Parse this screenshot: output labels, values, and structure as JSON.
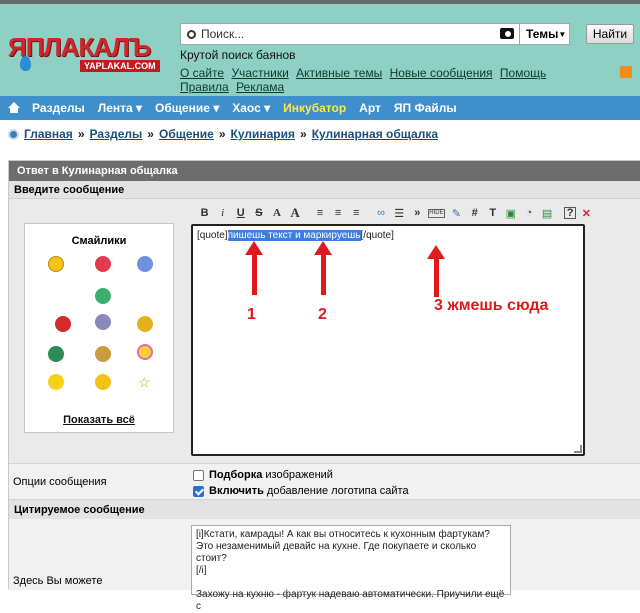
{
  "header": {
    "logo_text": "ЯПЛАКАЛЪ",
    "logo_sub": "YAPLAKAL.COM",
    "search_placeholder": "Поиск...",
    "themes_label": "Темы",
    "find_label": "Найти",
    "tagline": "Крутой поиск баянов",
    "links": [
      "О сайте",
      "Участники",
      "Активные темы",
      "Новые сообщения",
      "Помощь",
      "Правила",
      "Реклама"
    ]
  },
  "nav": {
    "items": [
      {
        "label": "Разделы",
        "hot": false
      },
      {
        "label": "Лента ▾",
        "hot": false
      },
      {
        "label": "Общение ▾",
        "hot": false
      },
      {
        "label": "Хаос ▾",
        "hot": false
      },
      {
        "label": "Инкубатор",
        "hot": true
      },
      {
        "label": "Арт",
        "hot": false
      },
      {
        "label": "ЯП Файлы",
        "hot": false
      }
    ]
  },
  "breadcrumb": [
    "Главная",
    "Разделы",
    "Общение",
    "Кулинария",
    "Кулинарная общалка"
  ],
  "form": {
    "title": "Ответ в Кулинарная общалка",
    "enter_message": "Введите сообщение",
    "smilies_title": "Смайлики",
    "show_all": "Показать всё",
    "toolbar": [
      "B",
      "i",
      "U",
      "S",
      "A",
      "A",
      "≡",
      "≡",
      "≡",
      "∞",
      "☰",
      "»",
      "HIDE",
      "✎",
      "#",
      "T",
      "▣",
      "◔",
      "▤",
      "?",
      "✕"
    ],
    "textarea": {
      "prefix": "[quote]",
      "selected": "пишешь текст и маркируешь",
      "suffix": "[/quote]"
    },
    "annotations": [
      "1",
      "2",
      "3 жмешь сюда"
    ],
    "options_label": "Опции сообщения",
    "option1_bold": "Подборка",
    "option1_rest": "изображений",
    "option2_bold": "Включить",
    "option2_rest": "добавление логотипа сайта",
    "quoted_head": "Цитируемое сообщение",
    "quoted_label": "Здесь Вы можете",
    "quoted_lines": [
      "[i]Кстати, камрады! А как вы относитесь  к кухонным фартукам?",
      "Это незаменимый девайс на кухне.  Где покупаете и сколько стоит?",
      "[/i]",
      "",
      "Захожу на кухню - фартук надеваю автоматически. Приучили ещё с"
    ]
  },
  "colors": {
    "header_bg": "#8ed0c4",
    "nav_bg": "#3e8fcb",
    "accent_red": "#e01a1a",
    "selection": "#3d7fe0"
  }
}
